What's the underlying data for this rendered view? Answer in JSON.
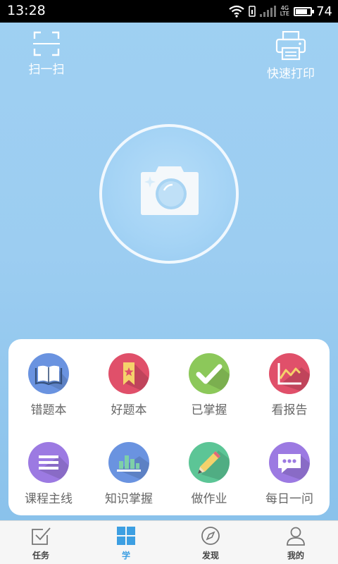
{
  "status_bar": {
    "time": "13:28",
    "network": "4G\nLTE",
    "battery": "74",
    "battery_level": 0.74
  },
  "top_actions": {
    "scan_label": "扫一扫",
    "print_label": "快速打印"
  },
  "camera": {
    "icon": "camera-icon"
  },
  "grid": {
    "items": [
      {
        "label": "错题本",
        "icon": "book-icon",
        "color": "#6a93e0"
      },
      {
        "label": "好题本",
        "icon": "bookmark-star-icon",
        "color": "#e0506a"
      },
      {
        "label": "已掌握",
        "icon": "check-icon",
        "color": "#8cc85a"
      },
      {
        "label": "看报告",
        "icon": "report-chart-icon",
        "color": "#e0506a"
      },
      {
        "label": "课程主线",
        "icon": "list-icon",
        "color": "#9c7ae2"
      },
      {
        "label": "知识掌握",
        "icon": "bar-chart-icon",
        "color": "#6a93e0"
      },
      {
        "label": "做作业",
        "icon": "pencil-icon",
        "color": "#5cc596"
      },
      {
        "label": "每日一问",
        "icon": "chat-bubble-icon",
        "color": "#9c7ae2"
      }
    ]
  },
  "bottom_nav": {
    "tabs": [
      {
        "label": "任务",
        "icon": "task-check-icon"
      },
      {
        "label": "学",
        "icon": "grid-icon",
        "active": true
      },
      {
        "label": "发现",
        "icon": "compass-icon"
      },
      {
        "label": "我的",
        "icon": "person-icon"
      }
    ]
  },
  "colors": {
    "accent": "#3d9fe2",
    "background": "#9fd0f2"
  }
}
